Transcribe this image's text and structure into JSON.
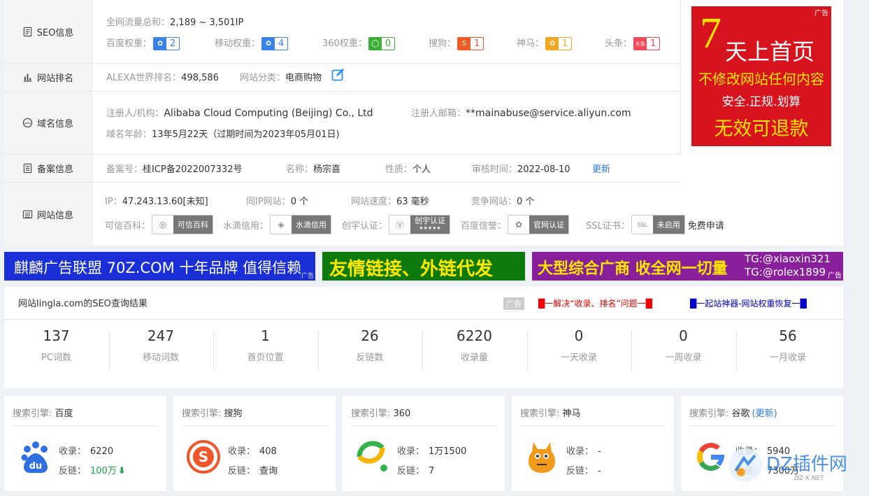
{
  "seo": {
    "label": "SEO信息",
    "traffic_label": "全网流量总和：",
    "traffic": "2,189 ~ 3,501IP",
    "weights": [
      {
        "label": "百度权重：",
        "value": "2",
        "color": "#3983e8",
        "icon": "baidu-paw-icon"
      },
      {
        "label": "移动权重：",
        "value": "4",
        "color": "#3983e8",
        "icon": "baidu-paw-icon"
      },
      {
        "label": "360权重：",
        "value": "0",
        "color": "#3cb034",
        "icon": "360-ring-icon"
      },
      {
        "label": "搜狗：",
        "value": "1",
        "color": "#f05a24",
        "icon": "sogou-icon"
      },
      {
        "label": "神马：",
        "value": "1",
        "color": "#f4a522",
        "icon": "shenma-icon"
      },
      {
        "label": "头条：",
        "value": "1",
        "color": "#f0495a",
        "icon": "toutiao-icon",
        "icon_text": "头条"
      }
    ]
  },
  "rank": {
    "label": "网站排名",
    "alexa_label": "ALEXA世界排名：",
    "alexa": "498,586",
    "cat_label": "网站分类：",
    "category": "电商购物"
  },
  "domain": {
    "label": "域名信息",
    "registrant_label": "注册人/机构：",
    "registrant": "Alibaba Cloud Computing (Beijing) Co., Ltd",
    "email_label": "注册人邮箱：",
    "email": "**mainabuse@service.aliyun.com",
    "age_label": "域名年龄：",
    "age": "13年5月22天（过期时间为2023年05月01日)"
  },
  "icp": {
    "label": "备案信息",
    "no_label": "备案号：",
    "no": "桂ICP备2022007332号",
    "name_label": "名称：",
    "name": "杨宗喜",
    "type_label": "性质：",
    "type": "个人",
    "time_label": "审核时间：",
    "time": "2022-08-10",
    "update": "更新"
  },
  "site": {
    "label": "网站信息",
    "ip_label": "IP：",
    "ip": "47.243.13.60[未知]",
    "sameip_label": "同IP网站：",
    "sameip": "0 个",
    "speed_label": "网站速度：",
    "speed": "63 毫秒",
    "comp_label": "竞争网站：",
    "comp": "0 个",
    "certs": [
      {
        "label": "可信百科：",
        "text": "可信百科"
      },
      {
        "label": "水滴信用：",
        "text": "水滴信用"
      },
      {
        "label": "创宇认证：",
        "text": "创宇认证",
        "sub": "★★★★★"
      },
      {
        "label": "百度信誉：",
        "text": "官网认证"
      },
      {
        "label": "SSL证书：",
        "text": "未启用",
        "icon_text": "SSL",
        "extra": "免费申请"
      }
    ]
  },
  "ad_right": {
    "tag": "广告",
    "big": "7",
    "line1": "天上首页",
    "line2": "不修改网站任何内容",
    "line3": "安全.正规.划算",
    "line4": "无效可退款"
  },
  "banners": [
    {
      "text": "麒麟广告联盟 70Z.COM 十年品牌 值得信赖",
      "tag": "广告",
      "bg": "#1a2fd6",
      "fg": "#ffffff"
    },
    {
      "text": "友情链接、外链代发",
      "bg": "#0c7a0c",
      "fg": "#ffe800"
    },
    {
      "text": "大型综合广商 收全网一切量",
      "tg1": "TG:@xiaoxin321",
      "tg2": "TG:@rolex1899",
      "tag": "广告",
      "bg": "#8a1f9b",
      "fg": "#ffe800"
    }
  ],
  "result": {
    "title": "网站lingla.com的SEO查询结果",
    "ad_tag": "广告",
    "link1": "█一解决“收录、排名”问题一█",
    "link2": "█一起站神器-网站权重恢复一█",
    "stats": [
      {
        "num": "137",
        "label": "PC词数"
      },
      {
        "num": "247",
        "label": "移动词数"
      },
      {
        "num": "1",
        "label": "首页位置"
      },
      {
        "num": "26",
        "label": "反链数"
      },
      {
        "num": "6220",
        "label": "收录量"
      },
      {
        "num": "0",
        "label": "一天收录"
      },
      {
        "num": "0",
        "label": "一周收录"
      },
      {
        "num": "56",
        "label": "一月收录"
      }
    ]
  },
  "engines": [
    {
      "prefix": "搜索引擎: ",
      "name": "百度",
      "icon": "baidu-logo-icon",
      "sl_label": "收录：",
      "sl": "6220",
      "fl_label": "反链：",
      "fl": "100万",
      "trend": "down"
    },
    {
      "prefix": "搜索引擎: ",
      "name": "搜狗",
      "icon": "sogou-logo-icon",
      "sl_label": "收录：",
      "sl": "408",
      "fl_label": "反链：",
      "fl": "查询"
    },
    {
      "prefix": "搜索引擎: ",
      "name": "360",
      "icon": "360-logo-icon",
      "sl_label": "收录：",
      "sl": "1万1500",
      "fl_label": "反链：",
      "fl": "7"
    },
    {
      "prefix": "搜索引擎: ",
      "name": "神马",
      "icon": "shenma-logo-icon",
      "sl_label": "收录：",
      "sl": "-",
      "fl_label": "反链：",
      "fl": "-"
    },
    {
      "prefix": "搜索引擎: ",
      "name": "谷歌",
      "extra": "(更新)",
      "icon": "google-logo-icon",
      "sl_label": "收录：",
      "sl": "5940",
      "fl_label": "反链：",
      "fl": "7300万"
    }
  ],
  "watermark": {
    "text": "DZ插件网",
    "sub": "DZ-X.NET"
  }
}
